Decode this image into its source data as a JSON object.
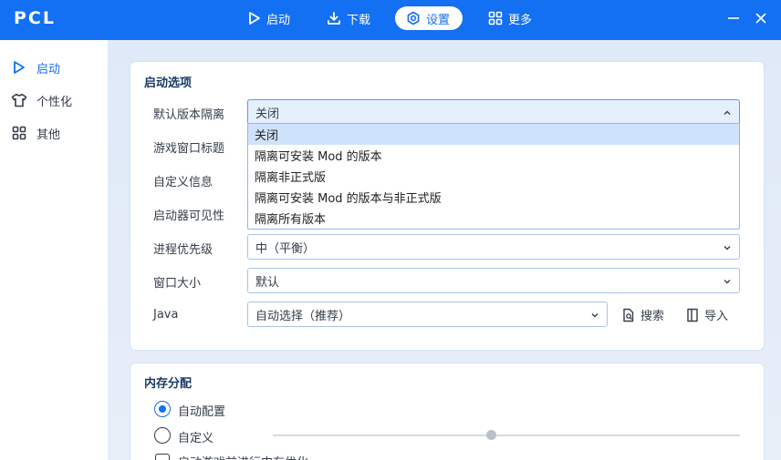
{
  "app": {
    "title": "PCL"
  },
  "topnav": [
    {
      "label": "启动",
      "icon": "play-icon"
    },
    {
      "label": "下载",
      "icon": "download-icon"
    },
    {
      "label": "设置",
      "icon": "gear-icon"
    },
    {
      "label": "更多",
      "icon": "grid-icon"
    }
  ],
  "sidebar": {
    "items": [
      {
        "label": "启动",
        "icon": "play-icon",
        "active": true
      },
      {
        "label": "个性化",
        "icon": "shirt-icon"
      },
      {
        "label": "其他",
        "icon": "grid-icon"
      }
    ]
  },
  "launch_card": {
    "title": "启动选项",
    "rows": {
      "isolation": {
        "label": "默认版本隔离",
        "value": "关闭"
      },
      "window_title": {
        "label": "游戏窗口标题"
      },
      "custom_info": {
        "label": "自定义信息"
      },
      "launcher_visibility": {
        "label": "启动器可见性"
      },
      "priority": {
        "label": "进程优先级",
        "value": "中（平衡）"
      },
      "window_size": {
        "label": "窗口大小",
        "value": "默认"
      },
      "java": {
        "label": "Java",
        "value": "自动选择（推荐）"
      }
    },
    "search_button": "搜索",
    "import_button": "导入",
    "dropdown_options": [
      "关闭",
      "隔离可安装 Mod 的版本",
      "隔离非正式版",
      "隔离可安装 Mod 的版本与非正式版",
      "隔离所有版本"
    ]
  },
  "memory_card": {
    "title": "内存分配",
    "auto_label": "自动配置",
    "custom_label": "自定义",
    "optimize_label": "启动游戏前进行内存优化"
  },
  "colors": {
    "accent": "#1370f3",
    "topbar": "#1370f3"
  }
}
